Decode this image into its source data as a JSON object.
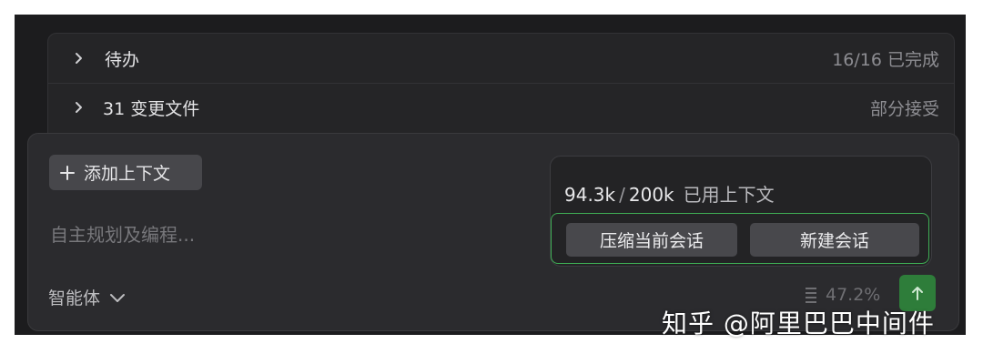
{
  "rows": [
    {
      "title": "待办",
      "status": "16/16 已完成"
    },
    {
      "title": "31 变更文件",
      "status": "部分接受"
    }
  ],
  "composer": {
    "add_context_label": "添加上下文",
    "placeholder": "自主规划及编程...",
    "agent_label": "智能体",
    "context_usage_percent": "47.2%"
  },
  "context_popover": {
    "used": "94.3k",
    "separator": "/",
    "total": "200k",
    "label": "已用上下文",
    "compress_button": "压缩当前会话",
    "new_session_button": "新建会话"
  },
  "watermark": "知乎 @阿里巴巴中间件",
  "colors": {
    "background": "#1c1c1e",
    "panel": "#2b2b2e",
    "accent_green": "#3fae55",
    "send_button": "#2e7d3a"
  },
  "icons": [
    "chevron-right-icon",
    "plus-icon",
    "chevron-down-icon",
    "bars-icon",
    "arrow-up-icon"
  ]
}
